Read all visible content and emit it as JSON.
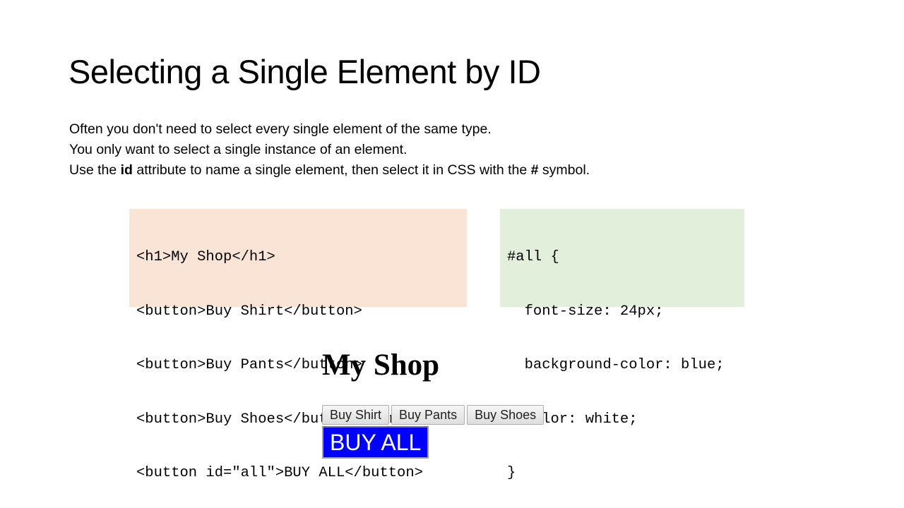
{
  "title": "Selecting a Single Element by ID",
  "body": {
    "line1": "Often you don't need to select every single element of the same type.",
    "line2": "You only want to select a single instance of an element.",
    "line3_pre": "Use the ",
    "line3_bold1": "id",
    "line3_mid": " attribute to name a single element, then select it in CSS with the ",
    "line3_bold2": "#",
    "line3_post": " symbol."
  },
  "html_code": [
    "<h1>My Shop</h1>",
    "<button>Buy Shirt</button>",
    "<button>Buy Pants</button>",
    "<button>Buy Shoes</button> <br>",
    "<button id=\"all\">BUY ALL</button>"
  ],
  "css_code": [
    "#all {",
    "  font-size: 24px;",
    "  background-color: blue;",
    "  color: white;",
    "}"
  ],
  "demo": {
    "heading": "My Shop",
    "buttons": [
      "Buy Shirt",
      "Buy Pants",
      "Buy Shoes"
    ],
    "buy_all": "BUY ALL"
  }
}
